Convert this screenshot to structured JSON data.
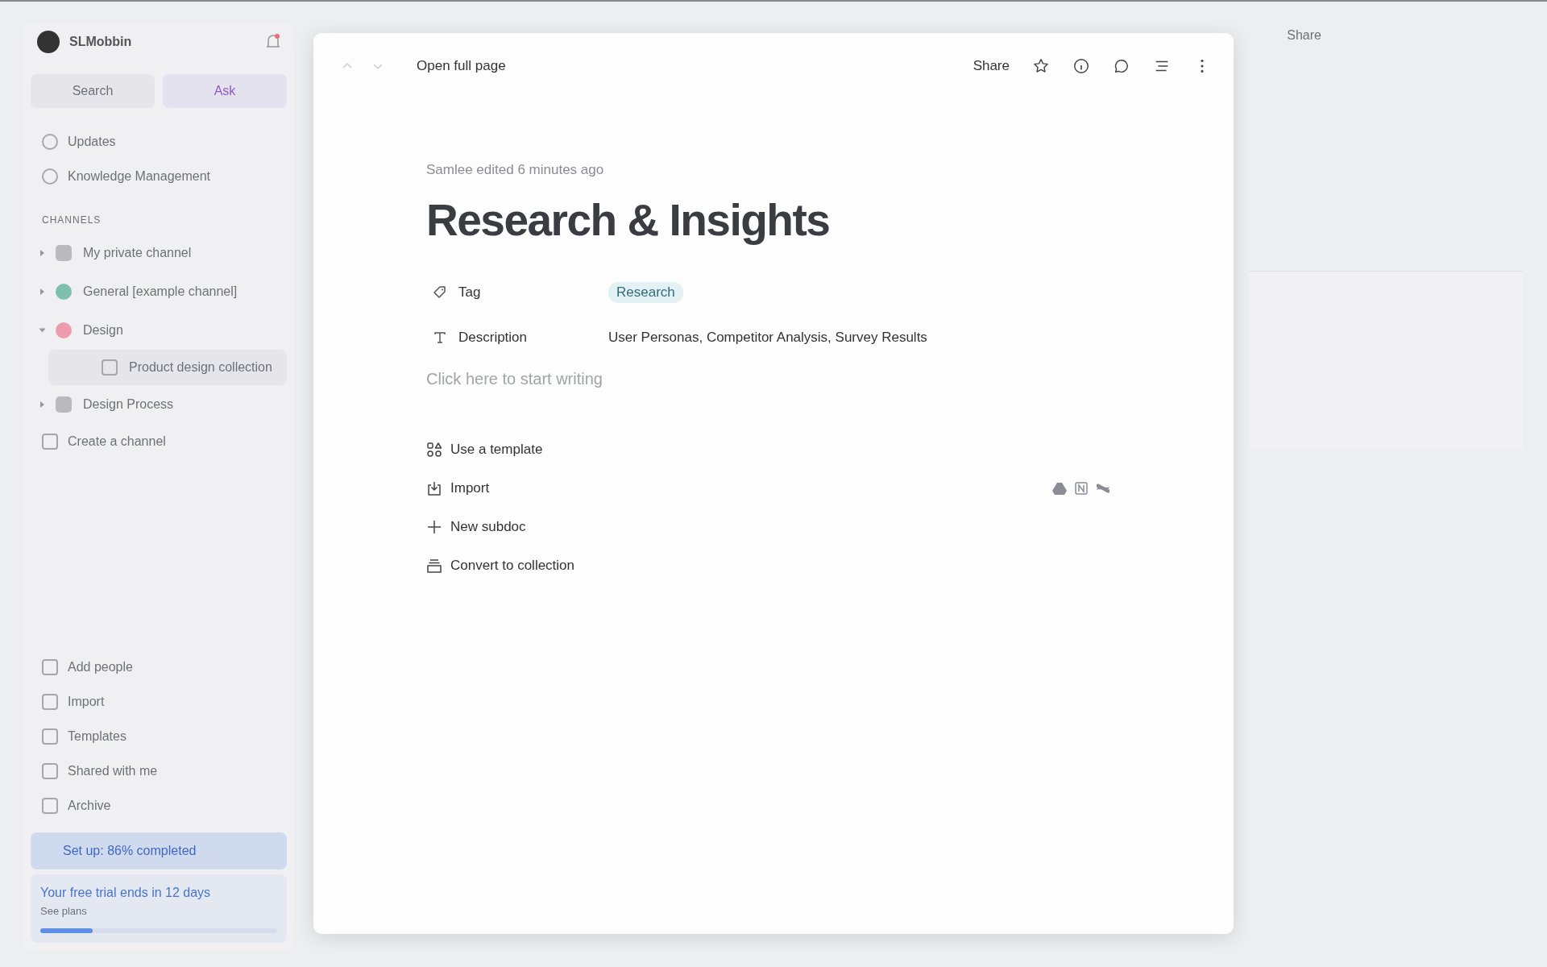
{
  "sidebar": {
    "workspace": "SLMobbin",
    "search": "Search",
    "ask": "Ask",
    "top_items": [
      {
        "label": "Updates"
      },
      {
        "label": "Knowledge Management"
      }
    ],
    "section_label": "CHANNELS",
    "channels": [
      {
        "label": "My private channel",
        "kind": "icon",
        "color": "#b9bac0",
        "expanded": false
      },
      {
        "label": "General [example channel]",
        "kind": "dot",
        "color": "#7fbfae",
        "expanded": false
      },
      {
        "label": "Design",
        "kind": "dot",
        "color": "#ee9bb0",
        "expanded": true,
        "children": [
          {
            "label": "Product design collection",
            "selected": true
          }
        ]
      },
      {
        "label": "Design Process",
        "kind": "icon",
        "color": "#b9bac0",
        "expanded": false
      }
    ],
    "create_channel": "Create a channel",
    "bottom_items": [
      {
        "label": "Add people"
      },
      {
        "label": "Import"
      },
      {
        "label": "Templates"
      },
      {
        "label": "Shared with me"
      },
      {
        "label": "Archive"
      }
    ],
    "setup": "Set up: 86% completed",
    "trial": {
      "title": "Your free trial ends in 12 days",
      "link": "See plans",
      "level": 0.22
    }
  },
  "background_toolbar": {
    "share": "Share"
  },
  "modal": {
    "open_full_page": "Open full page",
    "share": "Share",
    "edited": "Samlee edited 6 minutes ago",
    "title": "Research & Insights",
    "properties": [
      {
        "kind": "tag",
        "name": "Tag",
        "value": "Research"
      },
      {
        "kind": "text",
        "name": "Description",
        "value": "User Personas, Competitor Analysis, Survey Results"
      }
    ],
    "placeholder": "Click here to start writing",
    "actions": [
      {
        "label": "Use a template"
      },
      {
        "label": "Import"
      },
      {
        "label": "New subdoc"
      },
      {
        "label": "Convert to collection"
      }
    ]
  }
}
